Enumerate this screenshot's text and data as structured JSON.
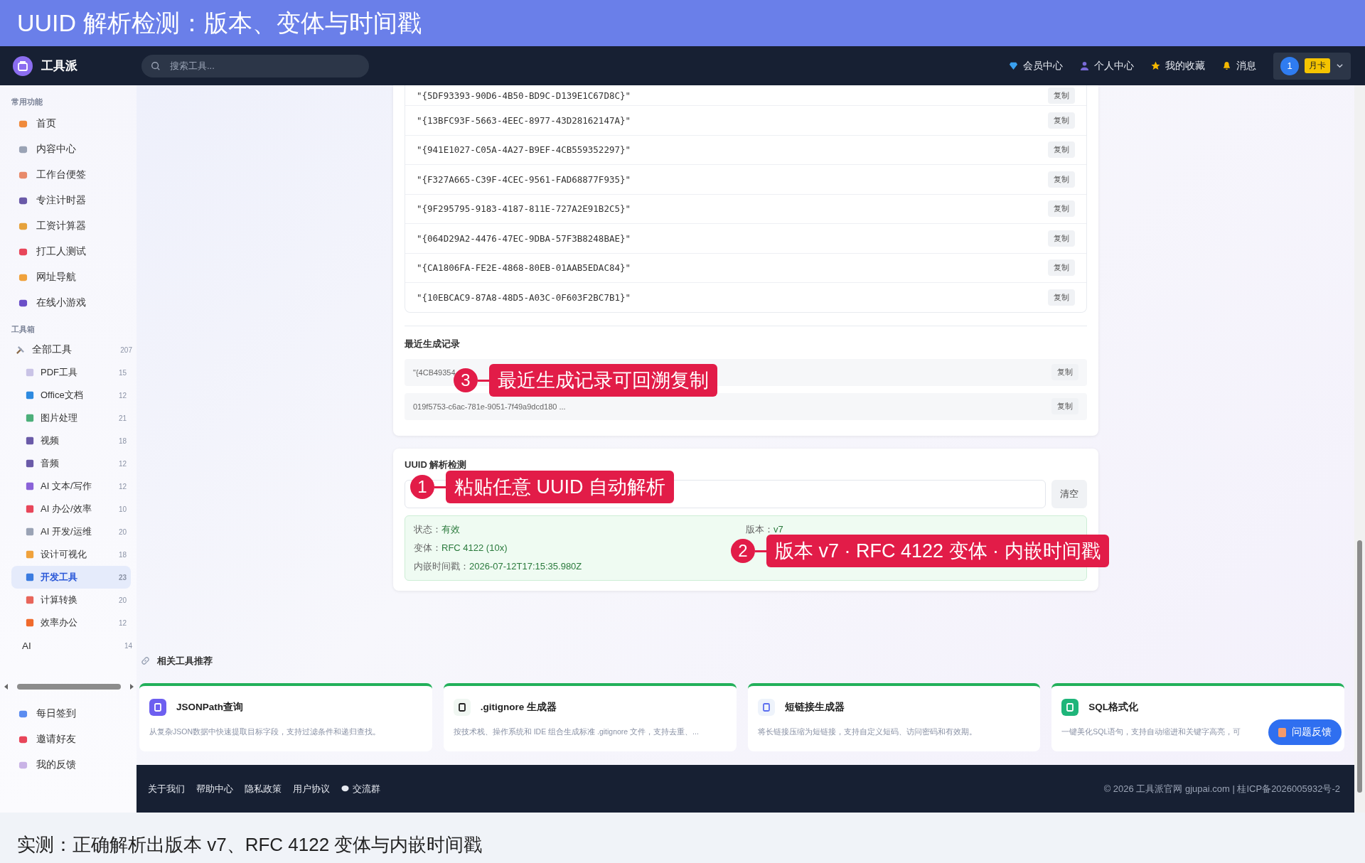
{
  "banner": {
    "title": "UUID 解析检测：版本、变体与时间戳"
  },
  "header": {
    "logo": "工具派",
    "search_placeholder": "搜索工具...",
    "nav": [
      {
        "label": "会员中心"
      },
      {
        "label": "个人中心"
      },
      {
        "label": "我的收藏"
      },
      {
        "label": "消息"
      }
    ],
    "user": {
      "badge": "1",
      "plan": "月卡"
    }
  },
  "sidebar": {
    "sections": [
      {
        "title": "常用功能",
        "items": [
          {
            "label": "首页"
          },
          {
            "label": "内容中心"
          },
          {
            "label": "工作台便签"
          },
          {
            "label": "专注计时器"
          },
          {
            "label": "工资计算器"
          },
          {
            "label": "打工人测试"
          },
          {
            "label": "网址导航"
          },
          {
            "label": "在线小游戏"
          }
        ]
      },
      {
        "title": "工具箱",
        "items": [
          {
            "label": "全部工具",
            "count": "207",
            "children": [
              {
                "label": "PDF工具",
                "count": "15",
                "selected": false
              },
              {
                "label": "Office文档",
                "count": "12",
                "selected": false
              },
              {
                "label": "图片处理",
                "count": "21",
                "selected": false
              },
              {
                "label": "视频",
                "count": "18",
                "selected": false
              },
              {
                "label": "音频",
                "count": "12",
                "selected": false
              },
              {
                "label": "AI 文本/写作",
                "count": "12",
                "selected": false
              },
              {
                "label": "AI 办公/效率",
                "count": "10",
                "selected": false
              },
              {
                "label": "AI 开发/运维",
                "count": "20",
                "selected": false
              },
              {
                "label": "设计可视化",
                "count": "18",
                "selected": false
              },
              {
                "label": "开发工具",
                "count": "23",
                "selected": true
              },
              {
                "label": "计算转换",
                "count": "20",
                "selected": false
              },
              {
                "label": "效率办公",
                "count": "12",
                "selected": false
              }
            ]
          },
          {
            "label": "AI",
            "count": "14"
          }
        ]
      }
    ],
    "bottom_items": [
      {
        "label": "每日签到"
      },
      {
        "label": "邀请好友"
      },
      {
        "label": "我的反馈"
      }
    ]
  },
  "uuid_list": [
    {
      "value": "\"{5DF93393-90D6-4B50-BD9C-D139E1C67D8C}\"",
      "action": "复制"
    },
    {
      "value": "\"{13BFC93F-5663-4EEC-8977-43D28162147A}\"",
      "action": "复制"
    },
    {
      "value": "\"{941E1027-C05A-4A27-B9EF-4CB559352297}\"",
      "action": "复制"
    },
    {
      "value": "\"{F327A665-C39F-4CEC-9561-FAD68877F935}\"",
      "action": "复制"
    },
    {
      "value": "\"{9F295795-9183-4187-811E-727A2E91B2C5}\"",
      "action": "复制"
    },
    {
      "value": "\"{064D29A2-4476-47EC-9DBA-57F3B8248BAE}\"",
      "action": "复制"
    },
    {
      "value": "\"{CA1806FA-FE2E-4868-80EB-01AAB5EDAC84}\"",
      "action": "复制"
    },
    {
      "value": "\"{10EBCAC9-87A8-48D5-A03C-0F603F2BC7B1}\"",
      "action": "复制"
    }
  ],
  "recent": {
    "title": "最近生成记录",
    "items": [
      {
        "value": "\"{4CB49354",
        "action": "复制"
      },
      {
        "value": "019f5753-c6ac-781e-9051-7f49a9dcd180 ...",
        "action": "复制"
      }
    ]
  },
  "parser": {
    "title": "UUID 解析检测",
    "clear": "清空",
    "results": [
      {
        "label": "状态：",
        "value": "有效"
      },
      {
        "label": "版本：",
        "value": "v7"
      },
      {
        "label": "变体：",
        "value": "RFC 4122 (10x)"
      },
      {
        "label": "内嵌时间戳：",
        "value": "2026-07-12T17:15:35.980Z"
      }
    ]
  },
  "related": {
    "title": "相关工具推荐",
    "cards": [
      {
        "name": "JSONPath查询",
        "desc": "从复杂JSON数据中快速提取目标字段，支持过滤条件和递归查找。"
      },
      {
        "name": ".gitignore 生成器",
        "desc": "按技术栈、操作系统和 IDE 组合生成标准 .gitignore 文件，支持去重、..."
      },
      {
        "name": "短链接生成器",
        "desc": "将长链接压缩为短链接，支持自定义短码、访问密码和有效期。"
      },
      {
        "name": "SQL格式化",
        "desc": "一键美化SQL语句，支持自动缩进和关键字高亮，可"
      }
    ]
  },
  "feedback_button": "问题反馈",
  "footer": {
    "links": [
      "关于我们",
      "帮助中心",
      "隐私政策",
      "用户协议",
      "交流群"
    ],
    "copyright": "© 2026 工具派官网 gjupai.com | 桂ICP备2026005932号-2"
  },
  "caption": "实测：正确解析出版本 v7、RFC 4122 变体与内嵌时间戳",
  "annotations": [
    {
      "number": "3",
      "text": "最近生成记录可回溯复制"
    },
    {
      "number": "1",
      "text": "粘贴任意 UUID 自动解析"
    },
    {
      "number": "2",
      "text": "版本 v7 · RFC 4122 变体 · 内嵌时间戳"
    }
  ]
}
